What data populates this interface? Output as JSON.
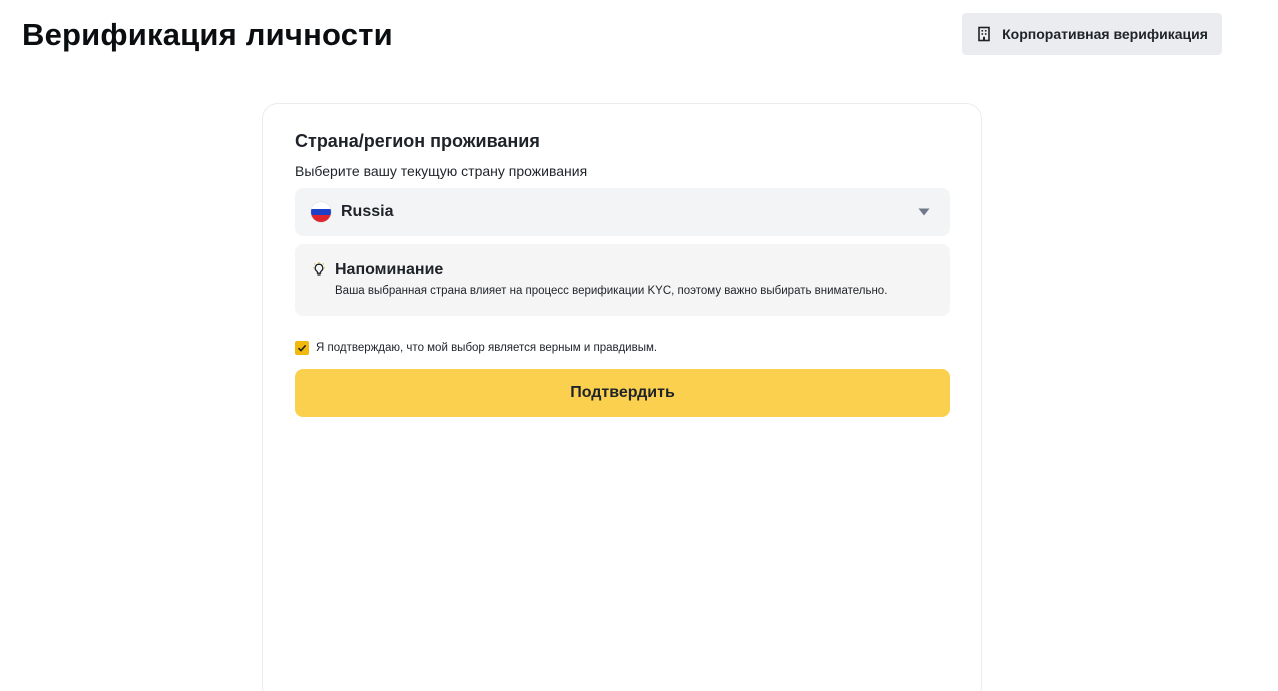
{
  "header": {
    "title": "Верификация личности",
    "corporate_button": {
      "label": "Корпоративная верификация",
      "icon": "building-icon"
    }
  },
  "card": {
    "section_title": "Страна/регион проживания",
    "section_subtitle": "Выберите вашу текущую страну проживания",
    "country_select": {
      "value": "Russia",
      "flag_icon": "russia-flag-icon",
      "dropdown_icon": "caret-down-icon"
    },
    "reminder": {
      "icon": "lightbulb-icon",
      "title": "Напоминание",
      "text": "Ваша выбранная страна влияет на процесс верификации KYC, поэтому важно выбирать внимательно."
    },
    "confirmation": {
      "checked": true,
      "label": "Я подтверждаю, что мой выбор является верным и правдивым."
    },
    "submit_label": "Подтвердить"
  },
  "colors": {
    "accent": "#fcd04f",
    "checkbox": "#f0b90b",
    "field_background": "#f3f4f6",
    "secondary_button": "#eaecef",
    "text": "#1e2329"
  }
}
